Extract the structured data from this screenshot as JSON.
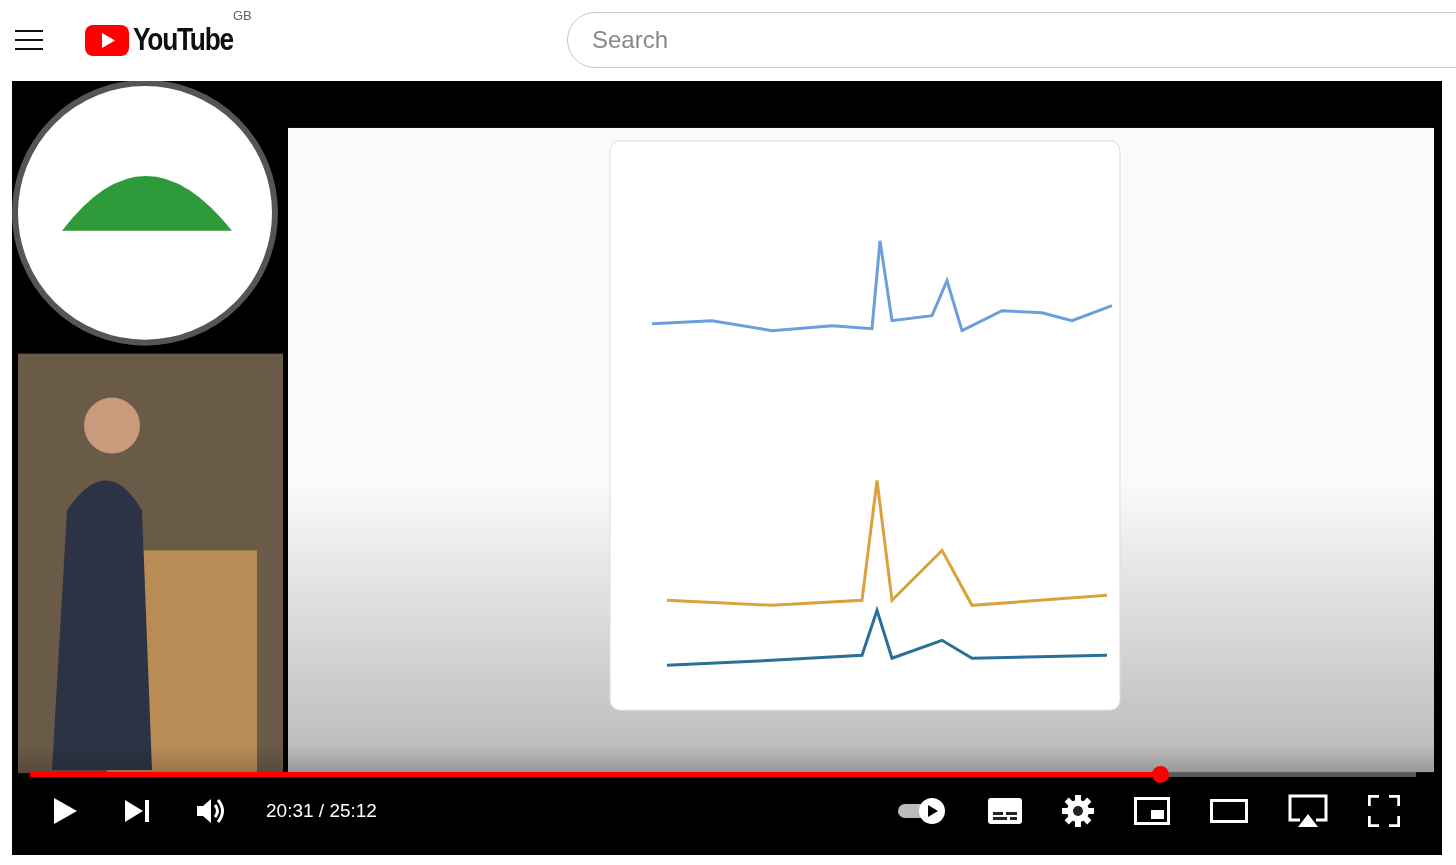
{
  "logo": {
    "text": "YouTube",
    "region": "GB"
  },
  "search": {
    "placeholder": "Search"
  },
  "player": {
    "progress": {
      "level": 0.815
    },
    "time": "20:31 / 25:12",
    "autoplay": {
      "on": true
    }
  }
}
